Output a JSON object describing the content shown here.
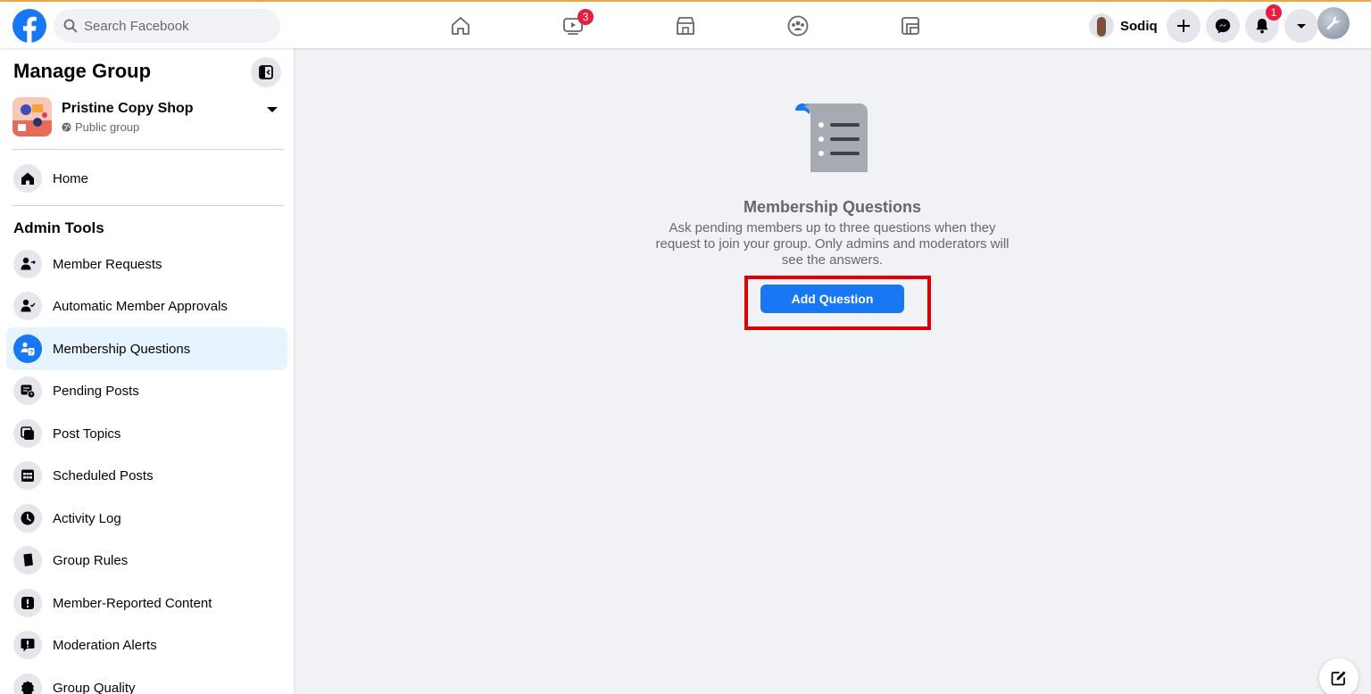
{
  "header": {
    "search_placeholder": "Search Facebook",
    "watch_badge": "3",
    "profile_name": "Sodiq",
    "notifications_badge": "1",
    "nav_icons": [
      "home-icon",
      "watch-icon",
      "marketplace-icon",
      "groups-icon",
      "gaming-icon"
    ]
  },
  "sidebar": {
    "title": "Manage Group",
    "group": {
      "name": "Pristine Copy Shop",
      "privacy": "Public group"
    },
    "home_label": "Home",
    "section_title": "Admin Tools",
    "items": [
      {
        "label": "Member Requests",
        "icon": "member-requests-icon"
      },
      {
        "label": "Automatic Member Approvals",
        "icon": "auto-approval-icon"
      },
      {
        "label": "Membership Questions",
        "icon": "membership-questions-icon",
        "active": true
      },
      {
        "label": "Pending Posts",
        "icon": "pending-posts-icon"
      },
      {
        "label": "Post Topics",
        "icon": "post-topics-icon"
      },
      {
        "label": "Scheduled Posts",
        "icon": "scheduled-posts-icon"
      },
      {
        "label": "Activity Log",
        "icon": "clock-icon"
      },
      {
        "label": "Group Rules",
        "icon": "rules-book-icon"
      },
      {
        "label": "Member-Reported Content",
        "icon": "report-icon"
      },
      {
        "label": "Moderation Alerts",
        "icon": "alert-icon"
      },
      {
        "label": "Group Quality",
        "icon": "quality-badge-icon"
      }
    ]
  },
  "main": {
    "title": "Membership Questions",
    "description": "Ask pending members up to three questions when they request to join your group. Only admins and moderators will see the answers.",
    "button_label": "Add Question"
  },
  "colors": {
    "brand_blue": "#1877f2",
    "highlight_red": "#e00000",
    "badge_red": "#e41e3f",
    "background": "#f0f2f5"
  }
}
